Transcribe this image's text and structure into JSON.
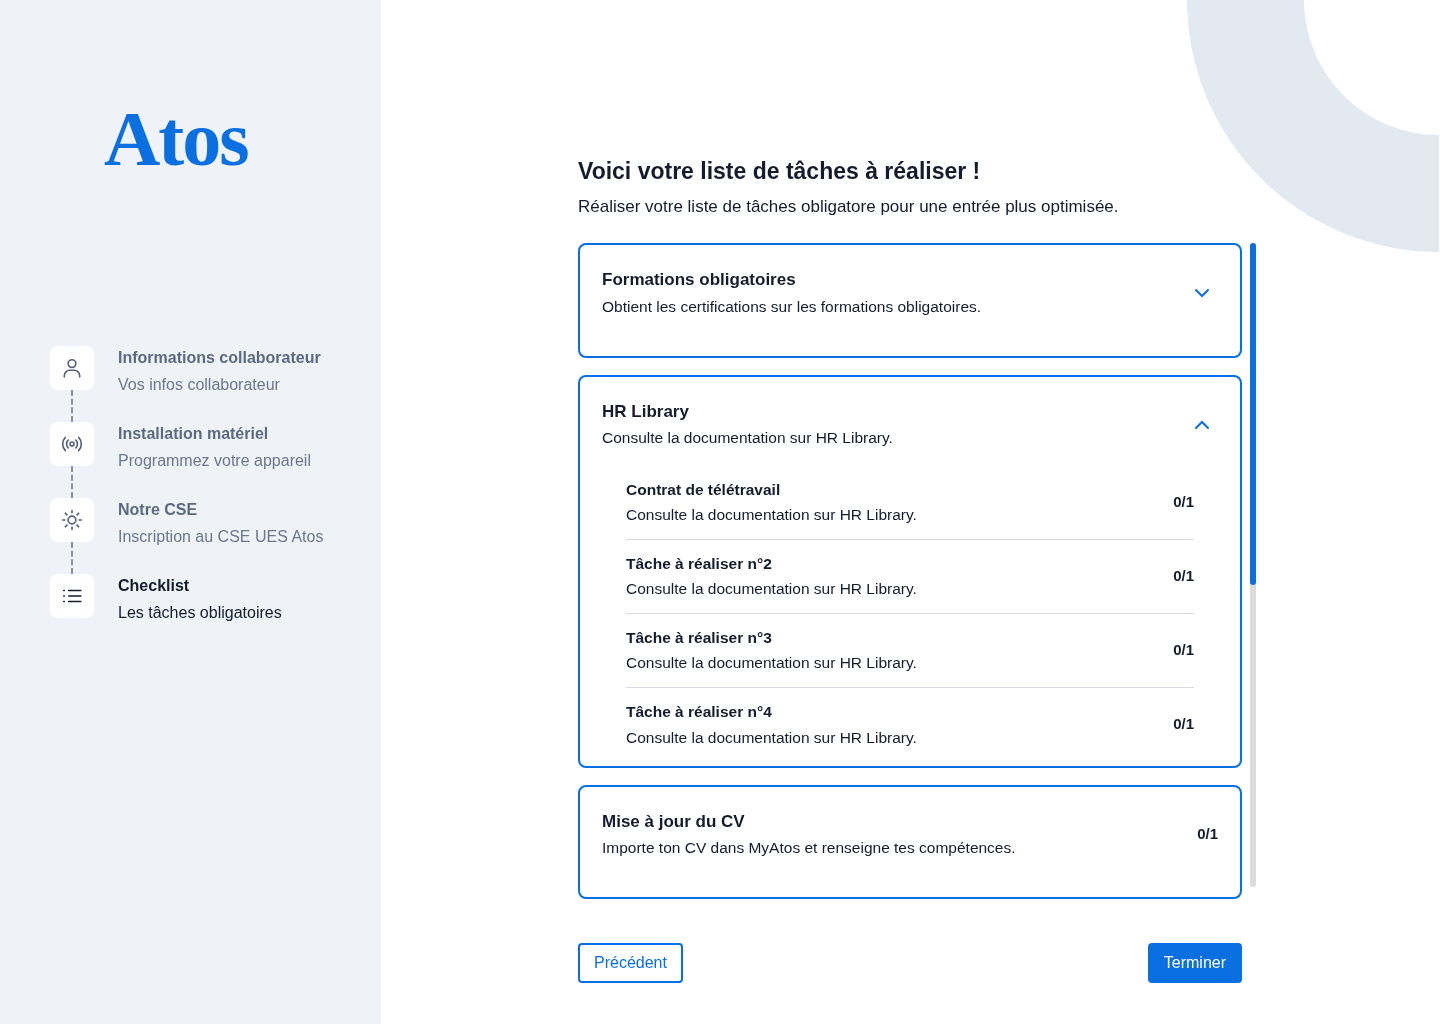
{
  "sidebar": {
    "logo": "Atos",
    "steps": [
      {
        "kind": "person",
        "title": "Informations collaborateur",
        "subtitle": "Vos infos collaborateur",
        "selected": false
      },
      {
        "kind": "signal",
        "title": "Installation matériel",
        "subtitle": "Programmez votre appareil",
        "selected": false
      },
      {
        "kind": "sun",
        "title": "Notre CSE",
        "subtitle": "Inscription au  CSE UES Atos",
        "selected": false
      },
      {
        "kind": "list",
        "title": "Checklist",
        "subtitle": "Les tâches obligatoires",
        "selected": true
      }
    ]
  },
  "main": {
    "title": "Voici votre liste de tâches à réaliser !",
    "subtitle": "Réaliser votre liste de tâches obligatore pour une entrée plus optimisée.",
    "sections": [
      {
        "kind": "accordion",
        "title": "Formations obligatoires",
        "description": "Obtient les certifications sur les formations obligatoires.",
        "expanded": false
      },
      {
        "kind": "accordion",
        "title": "HR Library",
        "description": "Consulte la documentation sur HR Library.",
        "expanded": true,
        "tasks": [
          {
            "title": "Contrat de télétravail",
            "description": "Consulte la documentation sur HR Library.",
            "count": "0/1"
          },
          {
            "title": "Tâche à réaliser n°2",
            "description": "Consulte la documentation sur HR Library.",
            "count": "0/1"
          },
          {
            "title": "Tâche à réaliser n°3",
            "description": "Consulte la documentation sur HR Library.",
            "count": "0/1"
          },
          {
            "title": "Tâche à réaliser n°4",
            "description": "Consulte la documentation sur HR Library.",
            "count": "0/1"
          }
        ]
      },
      {
        "kind": "task",
        "title": "Mise à jour du CV",
        "description": "Importe ton CV dans MyAtos et renseigne tes compétences.",
        "count": "0/1"
      }
    ],
    "buttons": {
      "previous": "Précédent",
      "finish": "Terminer"
    }
  }
}
